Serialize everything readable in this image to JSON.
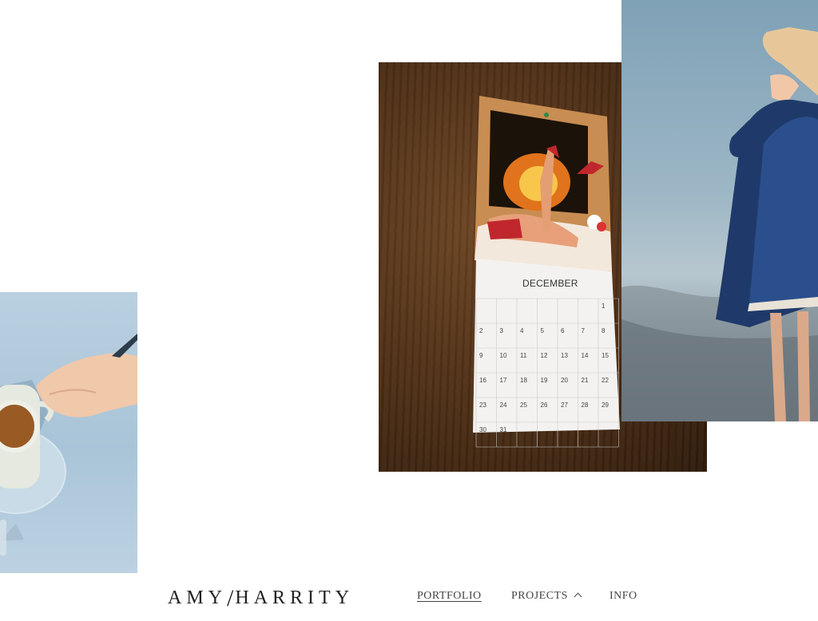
{
  "brand": {
    "first": "AMY",
    "separator": "/",
    "last": "HARRITY"
  },
  "nav": {
    "items": [
      {
        "label": "PORTFOLIO",
        "active": true
      },
      {
        "label": "PROJECTS",
        "icon": "chevron-up-icon"
      },
      {
        "label": "INFO"
      }
    ]
  },
  "photos": {
    "coffee": {
      "subject": "hand holding a cup of coffee on a saucer"
    },
    "calendar": {
      "month": "DECEMBER",
      "rows": [
        [
          "",
          "",
          "",
          "",
          "",
          "",
          "1"
        ],
        [
          "2",
          "3",
          "4",
          "5",
          "6",
          "7",
          "8"
        ],
        [
          "9",
          "10",
          "11",
          "12",
          "13",
          "14",
          "15"
        ],
        [
          "16",
          "17",
          "18",
          "19",
          "20",
          "21",
          "22"
        ],
        [
          "23",
          "24",
          "25",
          "26",
          "27",
          "28",
          "29"
        ],
        [
          "30",
          "31",
          "",
          "",
          "",
          "",
          ""
        ]
      ]
    },
    "dress": {
      "subject": "woman in blue coat and dress against sky"
    }
  },
  "colors": {
    "accent_text": "#444444",
    "logo": "#222222",
    "background": "#ffffff"
  }
}
